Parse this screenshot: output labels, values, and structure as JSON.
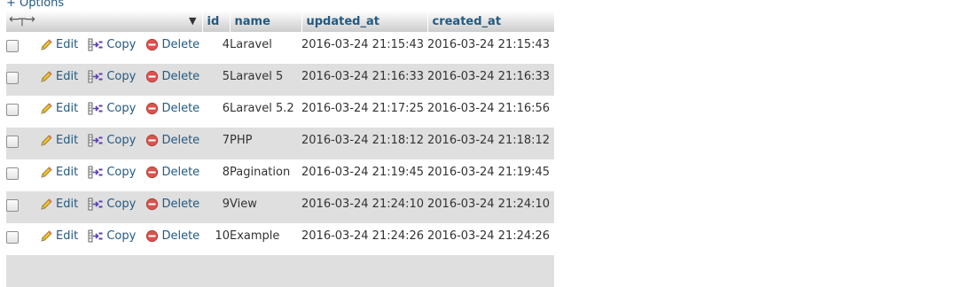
{
  "options_label": "+ Options",
  "columns": {
    "id": "id",
    "name": "name",
    "updated_at": "updated_at",
    "created_at": "created_at"
  },
  "actions": {
    "edit": "Edit",
    "copy": "Copy",
    "delete": "Delete"
  },
  "rows": [
    {
      "id": "4",
      "name": "Laravel",
      "updated_at": "2016-03-24 21:15:43",
      "created_at": "2016-03-24 21:15:43"
    },
    {
      "id": "5",
      "name": "Laravel 5",
      "updated_at": "2016-03-24 21:16:33",
      "created_at": "2016-03-24 21:16:33"
    },
    {
      "id": "6",
      "name": "Laravel 5.2",
      "updated_at": "2016-03-24 21:17:25",
      "created_at": "2016-03-24 21:16:56"
    },
    {
      "id": "7",
      "name": "PHP",
      "updated_at": "2016-03-24 21:18:12",
      "created_at": "2016-03-24 21:18:12"
    },
    {
      "id": "8",
      "name": "Pagination",
      "updated_at": "2016-03-24 21:19:45",
      "created_at": "2016-03-24 21:19:45"
    },
    {
      "id": "9",
      "name": "View",
      "updated_at": "2016-03-24 21:24:10",
      "created_at": "2016-03-24 21:24:10"
    },
    {
      "id": "10",
      "name": "Example",
      "updated_at": "2016-03-24 21:24:26",
      "created_at": "2016-03-24 21:24:26"
    }
  ],
  "colors": {
    "link": "#235a81",
    "row_alt": "#dfdfdf",
    "delete_icon": "#d9534f"
  },
  "icons": {
    "header_arrows": "column-resize-arrows-icon",
    "sort": "sort-down-triangle-icon",
    "edit": "pencil-icon",
    "copy": "copy-row-icon",
    "delete": "delete-circle-icon"
  }
}
